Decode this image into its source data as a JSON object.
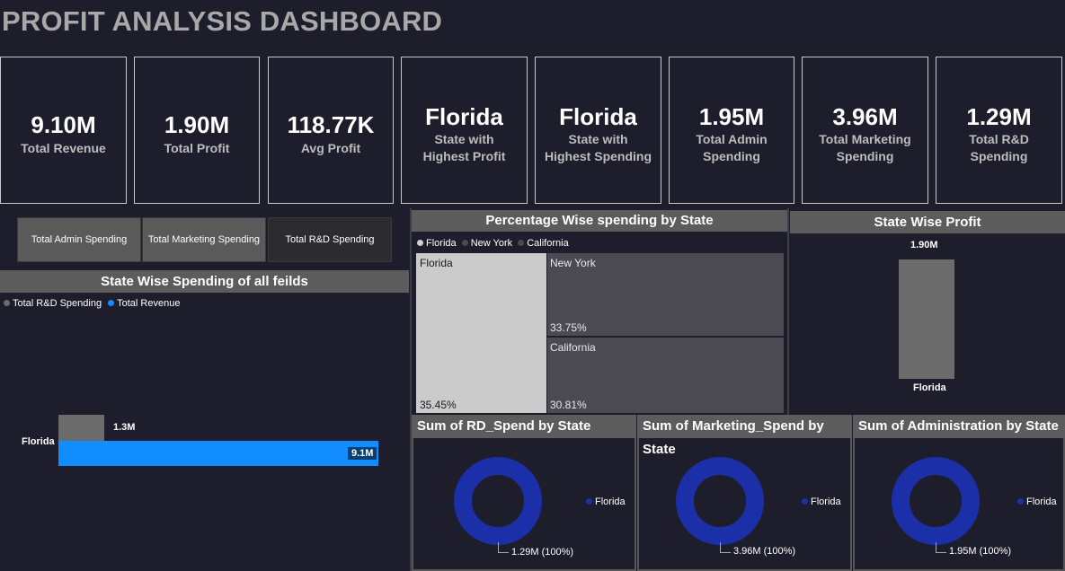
{
  "title": "PROFIT ANALYSIS DASHBOARD",
  "kpis": [
    {
      "value": "9.10M",
      "label": "Total Revenue"
    },
    {
      "value": "1.90M",
      "label": "Total Profit"
    },
    {
      "value": "118.77K",
      "label": "Avg Profit"
    },
    {
      "value": "Florida",
      "label": "State with Highest Profit"
    },
    {
      "value": "Florida",
      "label": "State with Highest Spending"
    },
    {
      "value": "1.95M",
      "label": "Total Admin Spending"
    },
    {
      "value": "3.96M",
      "label": "Total Marketing Spending"
    },
    {
      "value": "1.29M",
      "label": "Total R&D Spending"
    }
  ],
  "buttons": [
    {
      "label": "Total Admin Spending"
    },
    {
      "label": "Total Marketing Spending"
    },
    {
      "label": "Total R&D Spending",
      "selected": true
    }
  ],
  "state_spending": {
    "title": "State Wise Spending of all feilds",
    "legend": [
      {
        "name": "Total R&D Spending",
        "color": "#6b6b6b"
      },
      {
        "name": "Total Revenue",
        "color": "#118dff"
      }
    ],
    "category": "Florida",
    "bars": [
      {
        "series": "Total R&D Spending",
        "value": 1.3,
        "label": "1.3M",
        "color": "#6b6b6b"
      },
      {
        "series": "Total Revenue",
        "value": 9.1,
        "label": "9.1M",
        "color": "#118dff"
      }
    ],
    "max": 9.1
  },
  "treemap": {
    "title": "Percentage Wise spending by State",
    "legend": [
      {
        "name": "Florida",
        "color": "#d0d0d0"
      },
      {
        "name": "New York",
        "color": "#4a4a52"
      },
      {
        "name": "California",
        "color": "#4a4a52"
      }
    ],
    "cells": [
      {
        "name": "Florida",
        "pct": "35.45%",
        "value": 35.45
      },
      {
        "name": "New York",
        "pct": "33.75%",
        "value": 33.75
      },
      {
        "name": "California",
        "pct": "30.81%",
        "value": 30.81
      }
    ]
  },
  "profit": {
    "title": "State Wise Profit",
    "value_label": "1.90M",
    "category": "Florida"
  },
  "donuts": [
    {
      "title": "Sum of RD_Spend by State",
      "legend": "Florida",
      "label": "1.29M (100%)"
    },
    {
      "title": "Sum of Marketing_Spend by State",
      "legend": "Florida",
      "label": "3.96M (100%)"
    },
    {
      "title": "Sum of Administration by State",
      "legend": "Florida",
      "label": "1.95M (100%)"
    }
  ],
  "colors": {
    "background": "#1e1d2b",
    "panel_header": "#5c5c5c",
    "accent_blue": "#118dff",
    "donut": "#1a2fa8"
  },
  "chart_data": [
    {
      "type": "bar",
      "title": "State Wise Spending of all feilds",
      "categories": [
        "Florida"
      ],
      "series": [
        {
          "name": "Total R&D Spending",
          "values": [
            1.3
          ]
        },
        {
          "name": "Total Revenue",
          "values": [
            9.1
          ]
        }
      ]
    },
    {
      "type": "heatmap",
      "title": "Percentage Wise spending by State",
      "categories": [
        "Florida",
        "New York",
        "California"
      ],
      "values": [
        35.45,
        33.75,
        30.81
      ]
    },
    {
      "type": "bar",
      "title": "State Wise Profit",
      "categories": [
        "Florida"
      ],
      "values": [
        1.9
      ]
    },
    {
      "type": "pie",
      "title": "Sum of RD_Spend by State",
      "categories": [
        "Florida"
      ],
      "values": [
        1.29
      ]
    },
    {
      "type": "pie",
      "title": "Sum of Marketing_Spend by State",
      "categories": [
        "Florida"
      ],
      "values": [
        3.96
      ]
    },
    {
      "type": "pie",
      "title": "Sum of Administration by State",
      "categories": [
        "Florida"
      ],
      "values": [
        1.95
      ]
    }
  ]
}
